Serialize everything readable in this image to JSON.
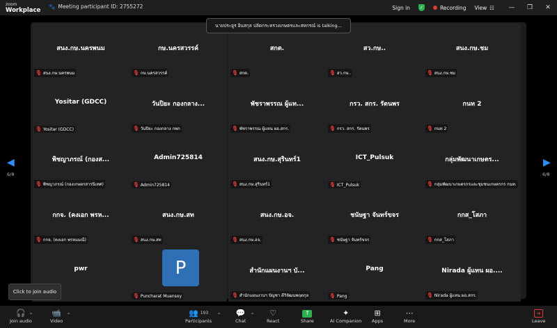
{
  "app": {
    "logo_line1": "zoom",
    "logo_line2": "Workplace"
  },
  "titlebar": {
    "meeting_id": "Meeting participant ID: 2755272",
    "sign_in": "Sign in",
    "recording": "Recording",
    "view": "View"
  },
  "talking_banner": "นายประยูร อินสกุล ปลัดกระทรวงเกษตรและสหกรณ์ is talking...",
  "pager": {
    "left": "6/8",
    "right": "6/8"
  },
  "tooltip": "Click to join audio",
  "tiles": [
    {
      "name": "สนง.กษ.นครพนม",
      "label": "สนง.กษ.นครพนม"
    },
    {
      "name": "กษ.นครสวรรค์",
      "label": "กษ.นครสวรรค์"
    },
    {
      "name": "สกต.",
      "label": "สกต."
    },
    {
      "name": "สว.กษ..",
      "label": "สว.กษ.."
    },
    {
      "name": "สนง.กษ.ชม",
      "label": "สนง.กษ.ชม"
    },
    {
      "name": "Yositar (GDCC)",
      "label": "Yositar (GDCC)"
    },
    {
      "name": "วันปิยะ กองกลาง...",
      "label": "วันปิยะ กองกลาง กพก"
    },
    {
      "name": "พัชราพรรณ ผู้แท...",
      "label": "พัชราพรรณ ผู้แทน ผอ.สกร."
    },
    {
      "name": "กรว. สกร. รัตนพร",
      "label": "กรว. สกร. รัตนพร"
    },
    {
      "name": "กนท 2",
      "label": "กนท 2"
    },
    {
      "name": "พิชญาภรณ์ (กองส...",
      "label": "พิชญาภรณ์ (กองเกษตรสารนิเทศ)"
    },
    {
      "name": "Admin725814",
      "label": "Admin725814"
    },
    {
      "name": "สนง.กษ.สุรินทร์1",
      "label": "สนง.กษ.สุรินทร์1"
    },
    {
      "name": "ICT_Pulsuk",
      "label": "ICT_Pulsuk"
    },
    {
      "name": "กลุ่มพัฒนาเกษตร...",
      "label": "กลุ่มพัฒนาเกษตรกรและชุมชนเกษตรกร กนท."
    },
    {
      "name": "กกจ. (คงเอก พรห...",
      "label": "กกจ. (คงเอก พรหมมณี)"
    },
    {
      "name": "สนง.กษ.สท",
      "label": "สนง.กษ.สท"
    },
    {
      "name": "สนง.กษ.อจ.",
      "label": "สนง.กษ.อจ."
    },
    {
      "name": "ชนัษฐา จันทร์ขจร",
      "label": "ชนัษฐา จันทร์ขจร"
    },
    {
      "name": "กกส_โสภา",
      "label": "กกส_โสภา"
    },
    {
      "name": "pwr",
      "label": ""
    },
    {
      "name": "",
      "label": "Puncharat Muansoy",
      "avatar": "P"
    },
    {
      "name": "สำนักแผนงานฯ บั...",
      "label": "สำนักแผนงานฯ ปัญชา ดีวิจัฒนพฤตกุล"
    },
    {
      "name": "Pang",
      "label": "Pang"
    },
    {
      "name": "Nirada ผู้แทน ผอ....",
      "label": "Nirada ผู้แทน ผอ.สกร."
    }
  ],
  "toolbar": {
    "join_audio": "Join audio",
    "video": "Video",
    "participants": "Participants",
    "participants_count": "193",
    "chat": "Chat",
    "react": "React",
    "share": "Share",
    "ai_companion": "AI Companion",
    "apps": "Apps",
    "more": "More",
    "leave": "Leave"
  },
  "colors": {
    "accent": "#2d8cff",
    "recording": "#e53935",
    "share": "#2bb24c",
    "avatar": "#2f6fb6"
  }
}
